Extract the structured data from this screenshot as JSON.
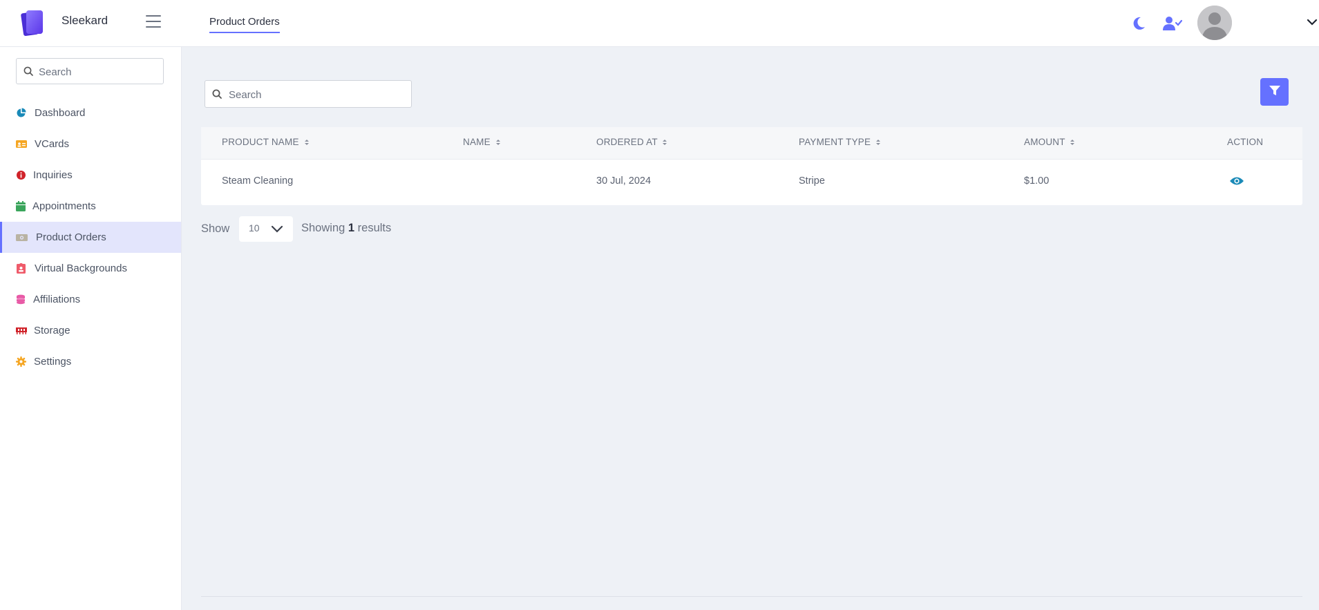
{
  "header": {
    "brand": "Sleekard",
    "active_tab": "Product Orders",
    "icons": [
      "moon-icon",
      "user-check-icon",
      "avatar",
      "chevron-down-icon"
    ]
  },
  "sidebar": {
    "search_placeholder": "Search",
    "items": [
      {
        "label": "Dashboard",
        "icon": "pie-chart-icon",
        "color": "#1a8ab8"
      },
      {
        "label": "VCards",
        "icon": "id-card-icon",
        "color": "#f5a623"
      },
      {
        "label": "Inquiries",
        "icon": "info-circle-icon",
        "color": "#d0232a"
      },
      {
        "label": "Appointments",
        "icon": "calendar-icon",
        "color": "#3ba55c"
      },
      {
        "label": "Product Orders",
        "icon": "money-bill-icon",
        "color": "#b9b3a3",
        "active": true
      },
      {
        "label": "Virtual Backgrounds",
        "icon": "id-badge-icon",
        "color": "#ef5b6a"
      },
      {
        "label": "Affiliations",
        "icon": "coins-icon",
        "color": "#e85aa6"
      },
      {
        "label": "Storage",
        "icon": "memory-icon",
        "color": "#d0232a"
      },
      {
        "label": "Settings",
        "icon": "gear-icon",
        "color": "#f5a623"
      }
    ]
  },
  "main": {
    "search_placeholder": "Search",
    "filter_icon": "filter-icon",
    "table": {
      "columns": [
        "PRODUCT NAME",
        "NAME",
        "ORDERED AT",
        "PAYMENT TYPE",
        "AMOUNT",
        "ACTION"
      ],
      "rows": [
        {
          "product_name": "Steam Cleaning",
          "name": "",
          "ordered_at": "30 Jul, 2024",
          "payment_type": "Stripe",
          "amount": "$1.00",
          "action_icon": "eye-icon"
        }
      ]
    },
    "pagination": {
      "show_label": "Show",
      "per_page": "10",
      "showing_prefix": "Showing",
      "showing_count": "1",
      "showing_suffix": "results"
    }
  },
  "colors": {
    "accent": "#6571ff",
    "background": "#eef1f6",
    "active_nav_bg": "#e3e5fc",
    "eye_icon": "#1a8ab8"
  }
}
